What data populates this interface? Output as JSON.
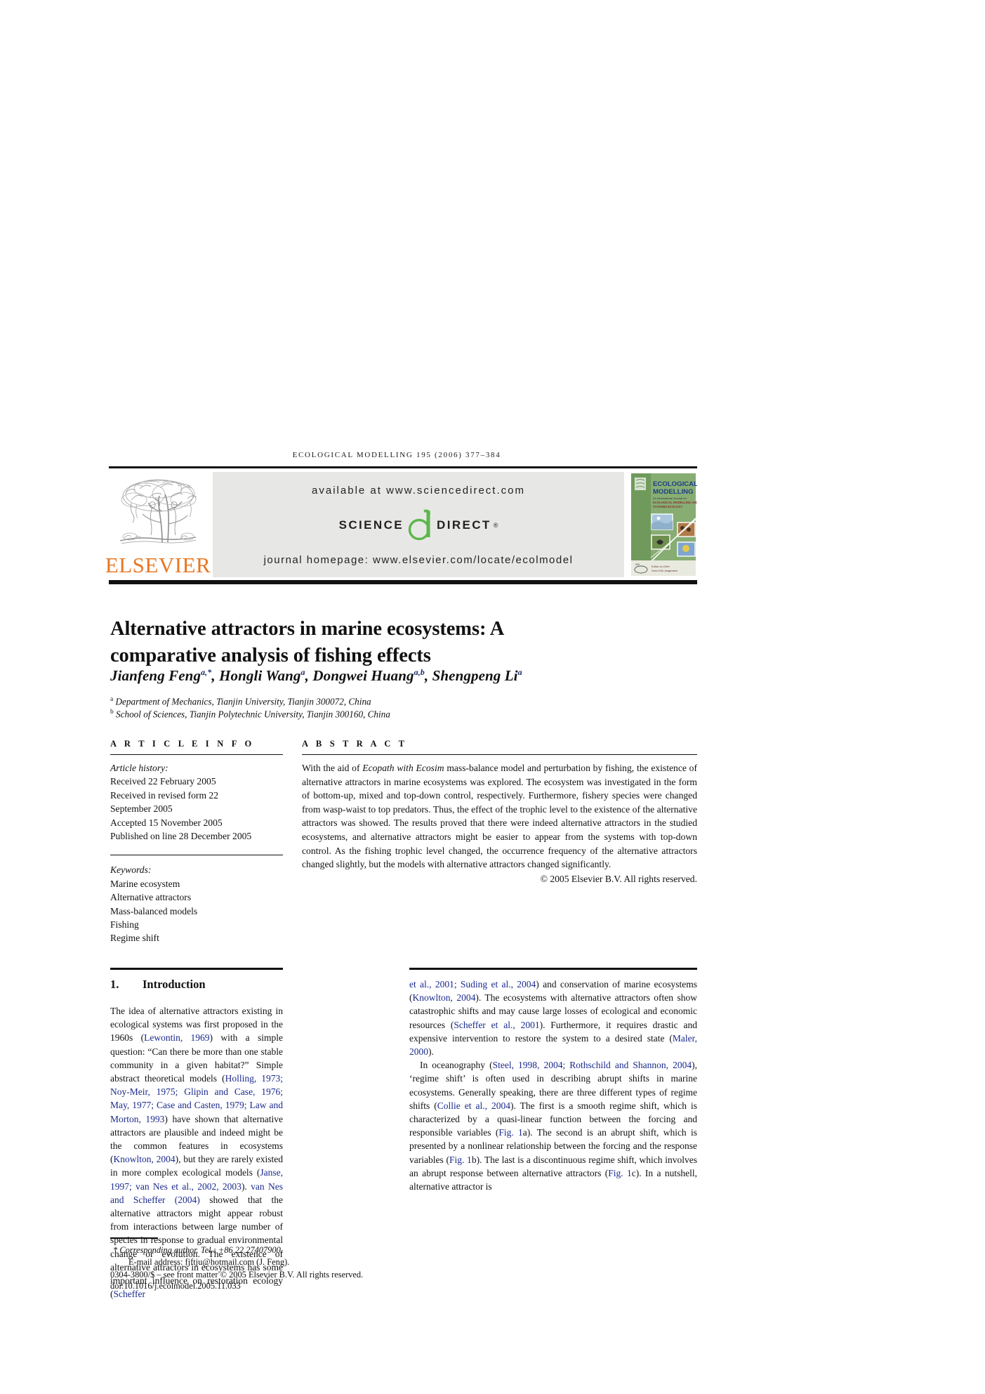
{
  "running_head": {
    "journal": "ECOLOGICAL MODELLING",
    "volume_issue": "195 (2006) 377-384",
    "full": "ECOLOGICAL MODELLING 195 (2006) 377–384"
  },
  "header_band": {
    "publisher_logo": {
      "name": "elsevier-logo",
      "wordmark": "ELSEVIER",
      "wordmark_color": "#e87722",
      "tree_icon": "elsevier-tree-icon"
    },
    "sciencedirect": {
      "available_at": "available at www.sciencedirect.com",
      "logo_science": "SCIENCE",
      "logo_d": "d",
      "logo_direct": "DIRECT",
      "registered_mark": "®",
      "journal_homepage": "journal homepage: www.elsevier.com/locate/ecolmodel",
      "banner_bg": "#e7e8e6",
      "d_color": "#5cb64a"
    },
    "cover_thumbnail": {
      "title_line1": "ECOLOGICAL",
      "title_line2": "MODELLING",
      "subtitle_line1": "An International Journal on",
      "subtitle_line2": "ECOLOGICAL MODELLING AND",
      "subtitle_line3": "SYSTEMS ECOLOGY",
      "footer_line1": "Editor-in-Chief",
      "footer_line2": "Sven Erik Jørgensen",
      "bg_color": "#7faa6e"
    }
  },
  "article": {
    "title": "Alternative attractors in marine ecosystems: A comparative analysis of fishing effects",
    "authors_html": "Jianfeng Feng<sup>a,*</sup>, Hongli Wang<sup>a</sup>, Dongwei Huang<sup>a,b</sup>, Shengpeng Li<sup>a</sup>",
    "affiliation_a": "Department of Mechanics, Tianjin University, Tianjin 300072, China",
    "affiliation_b": "School of Sciences, Tianjin Polytechnic University, Tianjin 300160, China",
    "affiliation_a_marker": "a",
    "affiliation_b_marker": "b"
  },
  "article_info": {
    "heading": "A R T I C L E   I N F O",
    "history_label": "Article history:",
    "history": [
      "Received 22 February 2005",
      "Received in revised form 22",
      "September 2005",
      "Accepted 15 November 2005",
      "Published on line 28 December 2005"
    ],
    "keywords_label": "Keywords:",
    "keywords": [
      "Marine ecosystem",
      "Alternative attractors",
      "Mass-balanced models",
      "Fishing",
      "Regime shift"
    ]
  },
  "abstract": {
    "heading": "A B S T R A C T",
    "text_pre": "With the aid of ",
    "text_italic": "Ecopath with Ecosim",
    "text_post": " mass-balance model and perturbation by fishing, the existence of alternative attractors in marine ecosystems was explored. The ecosystem was investigated in the form of bottom-up, mixed and top-down control, respectively. Furthermore, fishery species were changed from wasp-waist to top predators. Thus, the effect of the trophic level to the existence of the alternative attractors was showed. The results proved that there were indeed alternative attractors in the studied ecosystems, and alternative attractors might be easier to appear from the systems with top-down control. As the fishing trophic level changed, the occurrence frequency of the alternative attractors changed slightly, but the models with alternative attractors changed significantly.",
    "copyright": "© 2005 Elsevier B.V. All rights reserved."
  },
  "body": {
    "section_number": "1.",
    "section_title": "Introduction",
    "left_column_html": "The idea of alternative attractors existing in ecological systems was first proposed in the 1960s (<span class=\"cite\">Lewontin, 1969</span>) with a simple question: &ldquo;Can there be more than one stable community in a given habitat?&rdquo; Simple abstract theoretical models (<span class=\"cite\">Holling, 1973; Noy-Meir, 1975; Glipin and Case, 1976; May, 1977; Case and Casten, 1979; Law and Morton, 1993</span>) have shown that alternative attractors are plausible and indeed might be the common features in ecosystems (<span class=\"cite\">Knowlton, 2004</span>), but they are rarely existed in more complex ecological models (<span class=\"cite\">Janse, 1997; van Nes et al., 2002, 2003</span>). <span class=\"cite\">van Nes and Scheffer (2004)</span> showed that the alternative attractors might appear robust from interactions between large number of species in response to gradual environmental change or evolution. The existence of alternative attractors in ecosystems has some important influence on restoration ecology (<span class=\"cite\">Scheffer</span>",
    "right_column_html": "<p><span class=\"cite\">et al., 2001; Suding et al., 2004</span>) and conservation of marine ecosystems (<span class=\"cite\">Knowlton, 2004</span>). The ecosystems with alternative attractors often show catastrophic shifts and may cause large losses of ecological and economic resources (<span class=\"cite\">Scheffer et al., 2001</span>). Furthermore, it requires drastic and expensive intervention to restore the system to a desired state (<span class=\"cite\">Maler, 2000</span>).</p><p>In oceanography (<span class=\"cite\">Steel, 1998, 2004; Rothschild and Shannon, 2004</span>), &lsquo;regime shift&rsquo; is often used in describing abrupt shifts in marine ecosystems. Generally speaking, there are three different types of regime shifts (<span class=\"cite\">Collie et al., 2004</span>). The first is a smooth regime shift, which is characterized by a quasi-linear function between the forcing and responsible variables (<span class=\"cite\">Fig. 1</span>a). The second is an abrupt shift, which is presented by a nonlinear relationship between the forcing and the response variables (<span class=\"cite\">Fig. 1</span>b). The last is a discontinuous regime shift, which involves an abrupt response between alternative attractors (<span class=\"cite\">Fig. 1</span>c). In a nutshell, alternative attractor is</p>"
  },
  "footnote": {
    "corresponding_marker": "*",
    "corresponding": "Corresponding author. Tel.: +86 22 27407900.",
    "email_label": "E-mail address:",
    "email": "fjftju@hotmail.com (J. Feng).",
    "front_matter": "0304-3800/$ – see front matter © 2005 Elsevier B.V. All rights reserved.",
    "doi": "doi:10.1016/j.ecolmodel.2005.11.033"
  }
}
